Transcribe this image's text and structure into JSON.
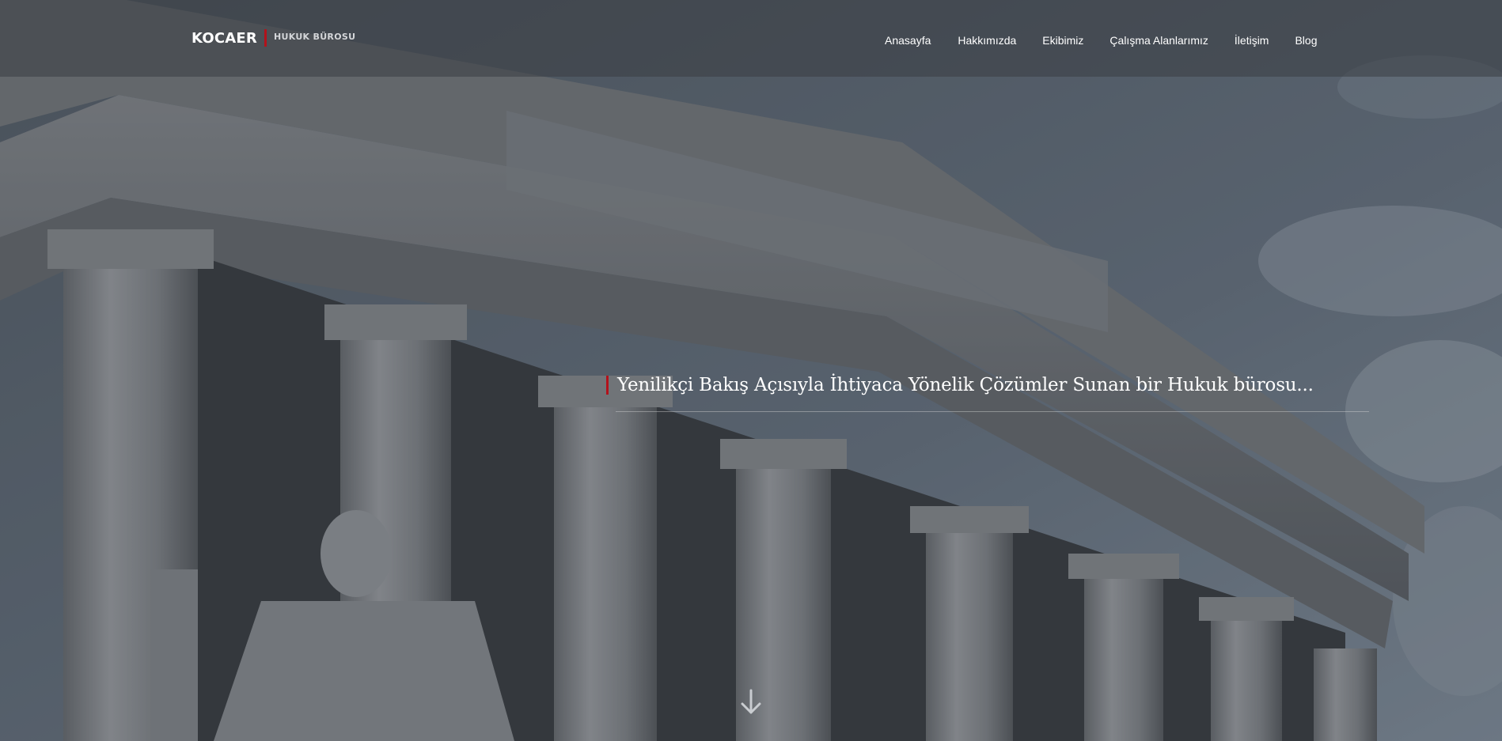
{
  "brand": {
    "name": "KOCAER",
    "subtitle": "HUKUK BÜROSU",
    "accent_color": "#b3121b"
  },
  "nav": {
    "items": [
      {
        "label": "Anasayfa"
      },
      {
        "label": "Hakkımızda"
      },
      {
        "label": "Ekibimiz"
      },
      {
        "label": "Çalışma Alanlarımız"
      },
      {
        "label": "İletişim"
      },
      {
        "label": "Blog"
      }
    ]
  },
  "hero": {
    "slogan": "Yenilikçi Bakış Açısıyla İhtiyaca Yönelik Çözümler Sunan bir Hukuk bürosu...",
    "background_image": "courthouse-columns-photo",
    "scroll_icon": "arrow-down-icon"
  }
}
